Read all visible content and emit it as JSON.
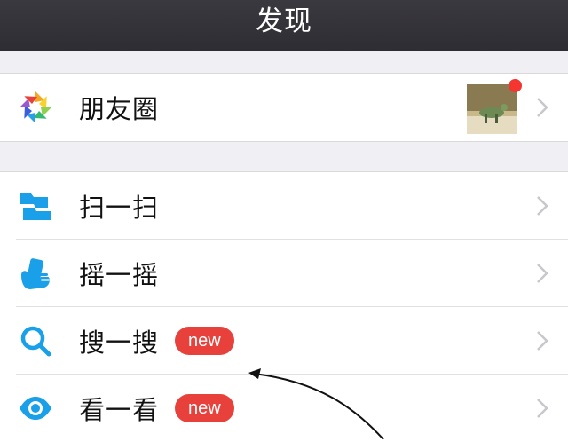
{
  "nav": {
    "title": "发现"
  },
  "moments": {
    "label": "朋友圈",
    "has_new": true
  },
  "tools": [
    {
      "label": "扫一扫",
      "icon": "scan-icon",
      "badge": ""
    },
    {
      "label": "摇一摇",
      "icon": "shake-icon",
      "badge": ""
    },
    {
      "label": "搜一搜",
      "icon": "search-icon",
      "badge": "new"
    },
    {
      "label": "看一看",
      "icon": "eye-icon",
      "badge": "new"
    }
  ],
  "colors": {
    "nav_bg": "#2e2d33",
    "accent_blue": "#1aa0e8",
    "badge_red": "#e8413c",
    "dot_red": "#f43530"
  }
}
